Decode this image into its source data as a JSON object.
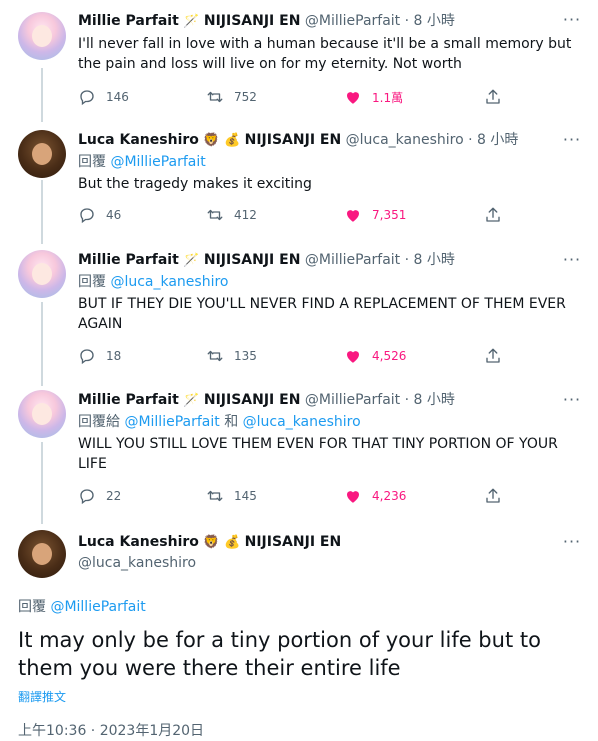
{
  "tweets": [
    {
      "name": "Millie Parfait",
      "emoji1": "🪄",
      "org": "NIJISANJI EN",
      "handle": "@MillieParfait",
      "time": "8 小時",
      "text": "I'll never fall in love with a human because it'll be a small memory but the pain and loss will live on for my eternity. Not worth",
      "replies": "146",
      "retweets": "752",
      "likes": "1.1萬"
    },
    {
      "name": "Luca Kaneshiro",
      "emoji1": "🦁",
      "emoji2": "💰",
      "org": "NIJISANJI EN",
      "handle": "@luca_kaneshiro",
      "time": "8 小時",
      "reply_prefix": "回覆",
      "reply_to": "@MillieParfait",
      "text": "But the tragedy makes it exciting",
      "replies": "46",
      "retweets": "412",
      "likes": "7,351"
    },
    {
      "name": "Millie Parfait",
      "emoji1": "🪄",
      "org": "NIJISANJI EN",
      "handle": "@MillieParfait",
      "time": "8 小時",
      "reply_prefix": "回覆",
      "reply_to": "@luca_kaneshiro",
      "text": "BUT IF THEY DIE YOU'LL NEVER FIND A REPLACEMENT OF THEM EVER AGAIN",
      "replies": "18",
      "retweets": "135",
      "likes": "4,526"
    },
    {
      "name": "Millie Parfait",
      "emoji1": "🪄",
      "org": "NIJISANJI EN",
      "handle": "@MillieParfait",
      "time": "8 小時",
      "reply_prefix": "回覆給",
      "reply_to": "@MillieParfait",
      "reply_and": "和",
      "reply_to2": "@luca_kaneshiro",
      "text": "WILL YOU STILL LOVE THEM EVEN FOR THAT TINY PORTION OF YOUR LIFE",
      "replies": "22",
      "retweets": "145",
      "likes": "4,236"
    }
  ],
  "main": {
    "name": "Luca Kaneshiro",
    "emoji1": "🦁",
    "emoji2": "💰",
    "org": "NIJISANJI EN",
    "handle": "@luca_kaneshiro",
    "reply_prefix": "回覆",
    "reply_to": "@MillieParfait",
    "text": "It may only be for a tiny portion of your life but to them you were there their entire life",
    "translate": "翻譯推文",
    "timestamp": "上午10:36 · 2023年1月20日"
  },
  "more_label": "···",
  "colors": {
    "link": "#1d9bf0",
    "like": "#f91880",
    "muted": "#536471",
    "line": "#cfd9de"
  },
  "icons": [
    "reply-icon",
    "retweet-icon",
    "heart-icon",
    "share-icon",
    "more-icon"
  ]
}
